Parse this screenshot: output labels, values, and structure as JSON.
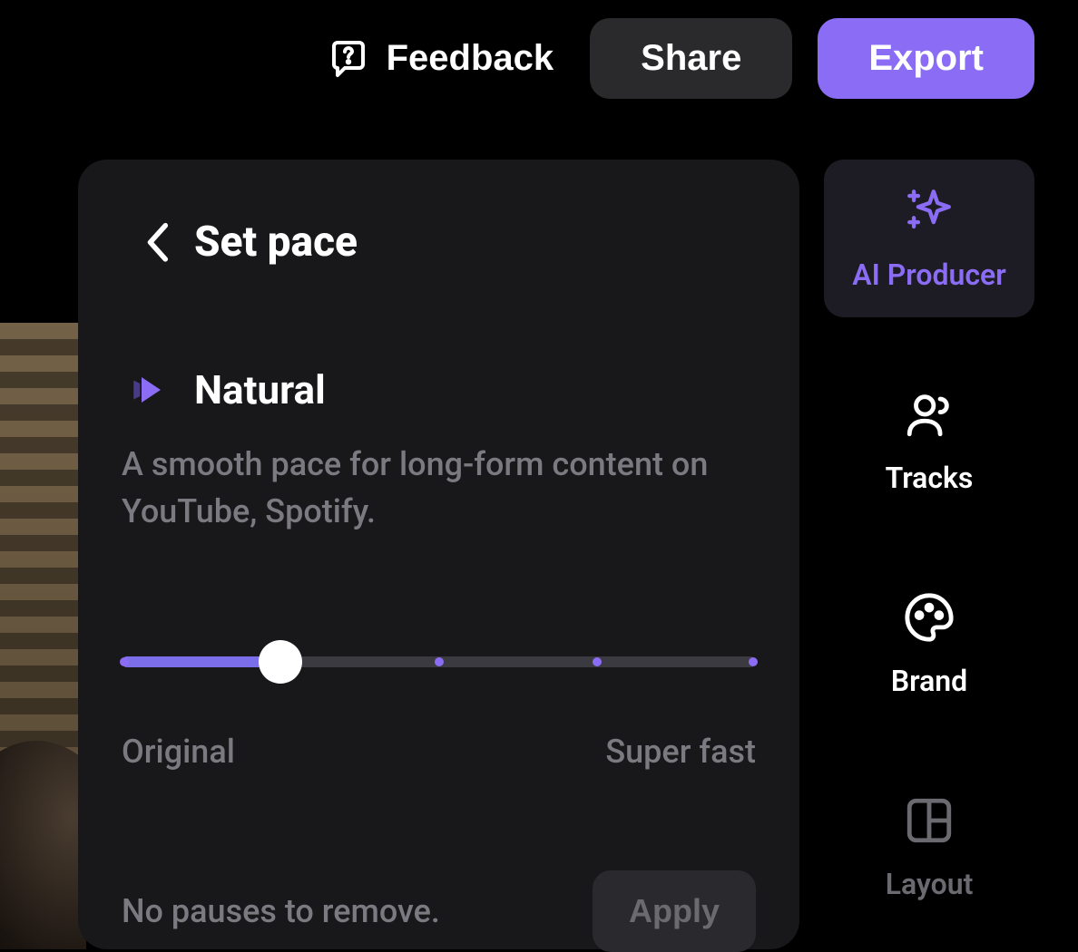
{
  "toolbar": {
    "feedback_label": "Feedback",
    "share_label": "Share",
    "export_label": "Export"
  },
  "panel": {
    "title": "Set pace",
    "pace_name": "Natural",
    "pace_description": "A smooth pace for long-form content on YouTube, Spotify.",
    "slider_min_label": "Original",
    "slider_max_label": "Super fast",
    "slider_value_percent": 25,
    "status_text": "No pauses to remove.",
    "apply_label": "Apply"
  },
  "sidebar": {
    "items": [
      {
        "label": "AI Producer",
        "icon": "sparkles-icon",
        "active": true
      },
      {
        "label": "Tracks",
        "icon": "people-icon",
        "active": false
      },
      {
        "label": "Brand",
        "icon": "palette-icon",
        "active": false
      },
      {
        "label": "Layout",
        "icon": "layout-icon",
        "active": false
      }
    ]
  },
  "colors": {
    "accent": "#8b6df5",
    "panel_bg": "#18181b",
    "muted_text": "#7a7a80"
  }
}
